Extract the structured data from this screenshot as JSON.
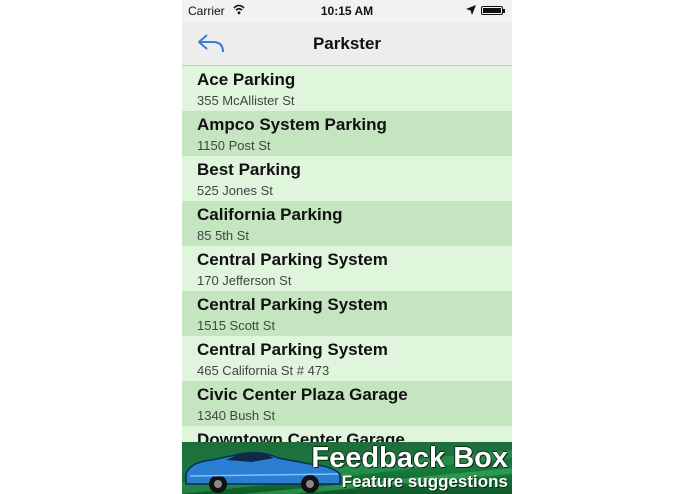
{
  "status_bar": {
    "carrier": "Carrier",
    "time": "10:15 AM"
  },
  "nav": {
    "title": "Parkster"
  },
  "list": [
    {
      "name": "Ace Parking",
      "address": "355 McAllister St"
    },
    {
      "name": "Ampco System Parking",
      "address": "1150 Post St"
    },
    {
      "name": "Best Parking",
      "address": "525 Jones St"
    },
    {
      "name": "California Parking",
      "address": "85 5th St"
    },
    {
      "name": "Central Parking System",
      "address": "170 Jefferson St"
    },
    {
      "name": "Central Parking System",
      "address": "1515 Scott St"
    },
    {
      "name": "Central Parking System",
      "address": "465 California St # 473"
    },
    {
      "name": "Civic Center Plaza Garage",
      "address": "1340 Bush St"
    },
    {
      "name": "Downtown Center Garage",
      "address": ""
    }
  ],
  "banner": {
    "headline": "Feedback Box",
    "subtitle": "Feature suggestions"
  },
  "colors": {
    "row_light": "#dff5dc",
    "row_dark": "#c5e5c1",
    "back_arrow": "#3a7bd5",
    "banner_green": "#167a3b"
  },
  "icons": {
    "back": "back-arrow-icon",
    "wifi": "wifi-icon",
    "location": "location-arrow-icon",
    "battery": "battery-icon"
  }
}
